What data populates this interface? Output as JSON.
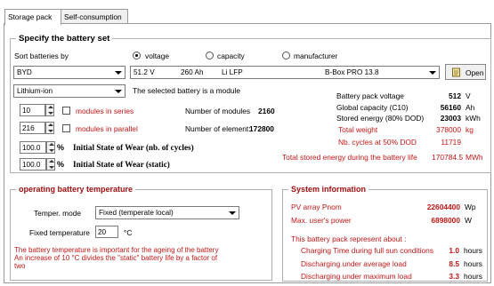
{
  "tabs": [
    {
      "label": "Storage pack",
      "active": true
    },
    {
      "label": "Self-consumption",
      "active": false
    }
  ],
  "battery_set": {
    "title": "Specify the battery set",
    "sort_label": "Sort batteries by",
    "sort_options": [
      {
        "label": "voltage",
        "selected": true
      },
      {
        "label": "capacity",
        "selected": false
      },
      {
        "label": "manufacturer",
        "selected": false
      }
    ],
    "manufacturer_value": "BYD",
    "battery_model": {
      "voltage": "51.2 V",
      "capacity": "260 Ah",
      "chemistry": "Li LFP",
      "model": "B-Box PRO 13.8"
    },
    "open_button": "Open",
    "technology_value": "Lithium-ion",
    "module_note": "The selected battery is a module",
    "series_value": "10",
    "series_label": "modules in series",
    "parallel_value": "216",
    "parallel_label": "modules in parallel",
    "num_modules_label": "Number of modules",
    "num_modules_value": "2160",
    "num_elements_label": "Number of element:",
    "num_elements_value": "172800",
    "wear_cycles_value": "100.0",
    "wear_cycles_unit": "%",
    "wear_cycles_label": "Initial State of Wear (nb. of cycles)",
    "wear_static_value": "100.0",
    "wear_static_unit": "%",
    "wear_static_label": "Initial State of Wear (static)",
    "stats": [
      {
        "label": "Battery pack voltage",
        "value": "512",
        "unit": "V",
        "bold": true,
        "red": false
      },
      {
        "label": "Global capacity (C10)",
        "value": "56160",
        "unit": "Ah",
        "bold": true,
        "red": false
      },
      {
        "label": "Stored energy (80% DOD)",
        "value": "23003",
        "unit": "kWh",
        "bold": true,
        "red": false
      },
      {
        "label": "Total weight",
        "value": "378000",
        "unit": "kg",
        "bold": false,
        "red": true
      },
      {
        "label": "Nb. cycles at 50% DOD",
        "value": "11719",
        "unit": "",
        "bold": false,
        "red": true
      }
    ],
    "total_stored_label": "Total stored energy during the battery life",
    "total_stored_value": "170784.5",
    "total_stored_unit": "MWh"
  },
  "temperature": {
    "title": "operating battery temperature",
    "mode_label": "Temper. mode",
    "mode_value": "Fixed  (temperate local)",
    "fixed_label": "Fixed temperature",
    "fixed_value": "20",
    "fixed_unit": "°C",
    "note_line1": "The battery temperature is important for the ageing of the battery",
    "note_line2": "An increase of 10 °C divides the \"static\" battery life by a factor of",
    "note_line3": "two"
  },
  "system": {
    "title": "System information",
    "pv_label": "PV array  Pnom",
    "pv_value": "22604400",
    "pv_unit": "Wp",
    "maxpow_label": "Max. user's power",
    "maxpow_value": "6898000",
    "maxpow_unit": "W",
    "represent_label": "This battery pack represent about :",
    "rows": [
      {
        "label": "Charging Time during full sun conditions",
        "value": "1.0",
        "unit": "hours"
      },
      {
        "label": "Discharging under average load",
        "value": "8.5",
        "unit": "hours"
      },
      {
        "label": "Discharging under maximum load",
        "value": "3.3",
        "unit": "hours"
      }
    ]
  },
  "colors": {
    "accent_red": "#c01818",
    "group_title": "#a01010"
  },
  "icons": {
    "open_button_icon": "open-file-icon",
    "combo_arrow": "chevron-down-icon"
  }
}
